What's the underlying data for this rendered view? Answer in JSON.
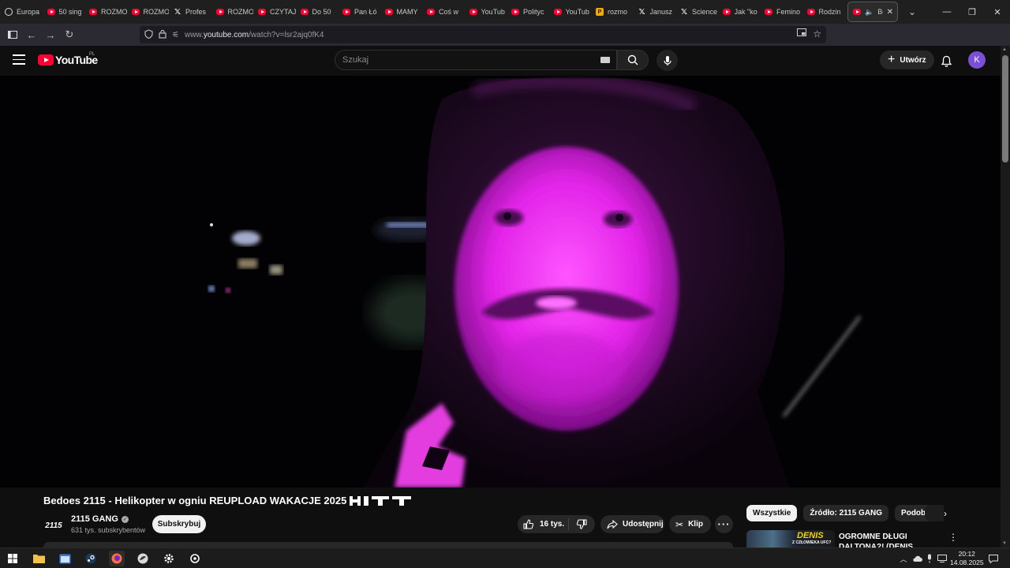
{
  "browser": {
    "tabs": [
      {
        "title": "Europa",
        "icon": "globe-icon"
      },
      {
        "title": "50 sing",
        "icon": "youtube-icon"
      },
      {
        "title": "ROZMO",
        "icon": "youtube-icon"
      },
      {
        "title": "ROZMO",
        "icon": "youtube-icon"
      },
      {
        "title": "Profes",
        "icon": "x-icon"
      },
      {
        "title": "ROZMO",
        "icon": "youtube-icon"
      },
      {
        "title": "CZYTAJ",
        "icon": "youtube-icon"
      },
      {
        "title": "Do 50",
        "icon": "youtube-icon"
      },
      {
        "title": "Pan Łó",
        "icon": "youtube-icon"
      },
      {
        "title": "MAMY",
        "icon": "youtube-icon"
      },
      {
        "title": "Coś w",
        "icon": "youtube-icon"
      },
      {
        "title": "YouTub",
        "icon": "youtube-icon"
      },
      {
        "title": "Polityc",
        "icon": "youtube-icon"
      },
      {
        "title": "YouTub",
        "icon": "youtube-icon"
      },
      {
        "title": "rozmo",
        "icon": "pk-icon"
      },
      {
        "title": "Janusz",
        "icon": "x-icon"
      },
      {
        "title": "Science",
        "icon": "x-icon"
      },
      {
        "title": "Jak \"ko",
        "icon": "youtube-icon"
      },
      {
        "title": "Femino",
        "icon": "youtube-icon"
      },
      {
        "title": "Rodzin",
        "icon": "youtube-icon"
      }
    ],
    "active_tab": {
      "title": "Bed"
    },
    "url_prefix": "www.",
    "url_domain": "youtube.com",
    "url_path": "/watch?v=lsr2ajq0fK4"
  },
  "youtube": {
    "logo_text": "YouTube",
    "country_code": "PL",
    "search_placeholder": "Szukaj",
    "create_label": "Utwórz",
    "avatar_letter": "K",
    "video": {
      "title": "Bedoes 2115 - Helikopter w ogniu REUPLOAD WAKACJE 2025",
      "channel_logo_text": "2115",
      "channel_name": "2115 GANG",
      "subscribers": "631 tys. subskrybentów",
      "subscribe_label": "Subskrybuj",
      "likes": "16 tys.",
      "share_label": "Udostępnij",
      "clip_label": "Klip"
    },
    "chips": [
      "Wszystkie",
      "Źródło: 2115 GANG",
      "Podobne"
    ],
    "recommendation": {
      "thumb_text": "DENIS",
      "thumb_subtext": "Z CZŁOWIEKA UFC?",
      "title": "OGROMNE DŁUGI DALTONA?! (DENIS, FAME, POLAK"
    }
  },
  "taskbar": {
    "time": "20:12",
    "date": "14.08.2025"
  }
}
